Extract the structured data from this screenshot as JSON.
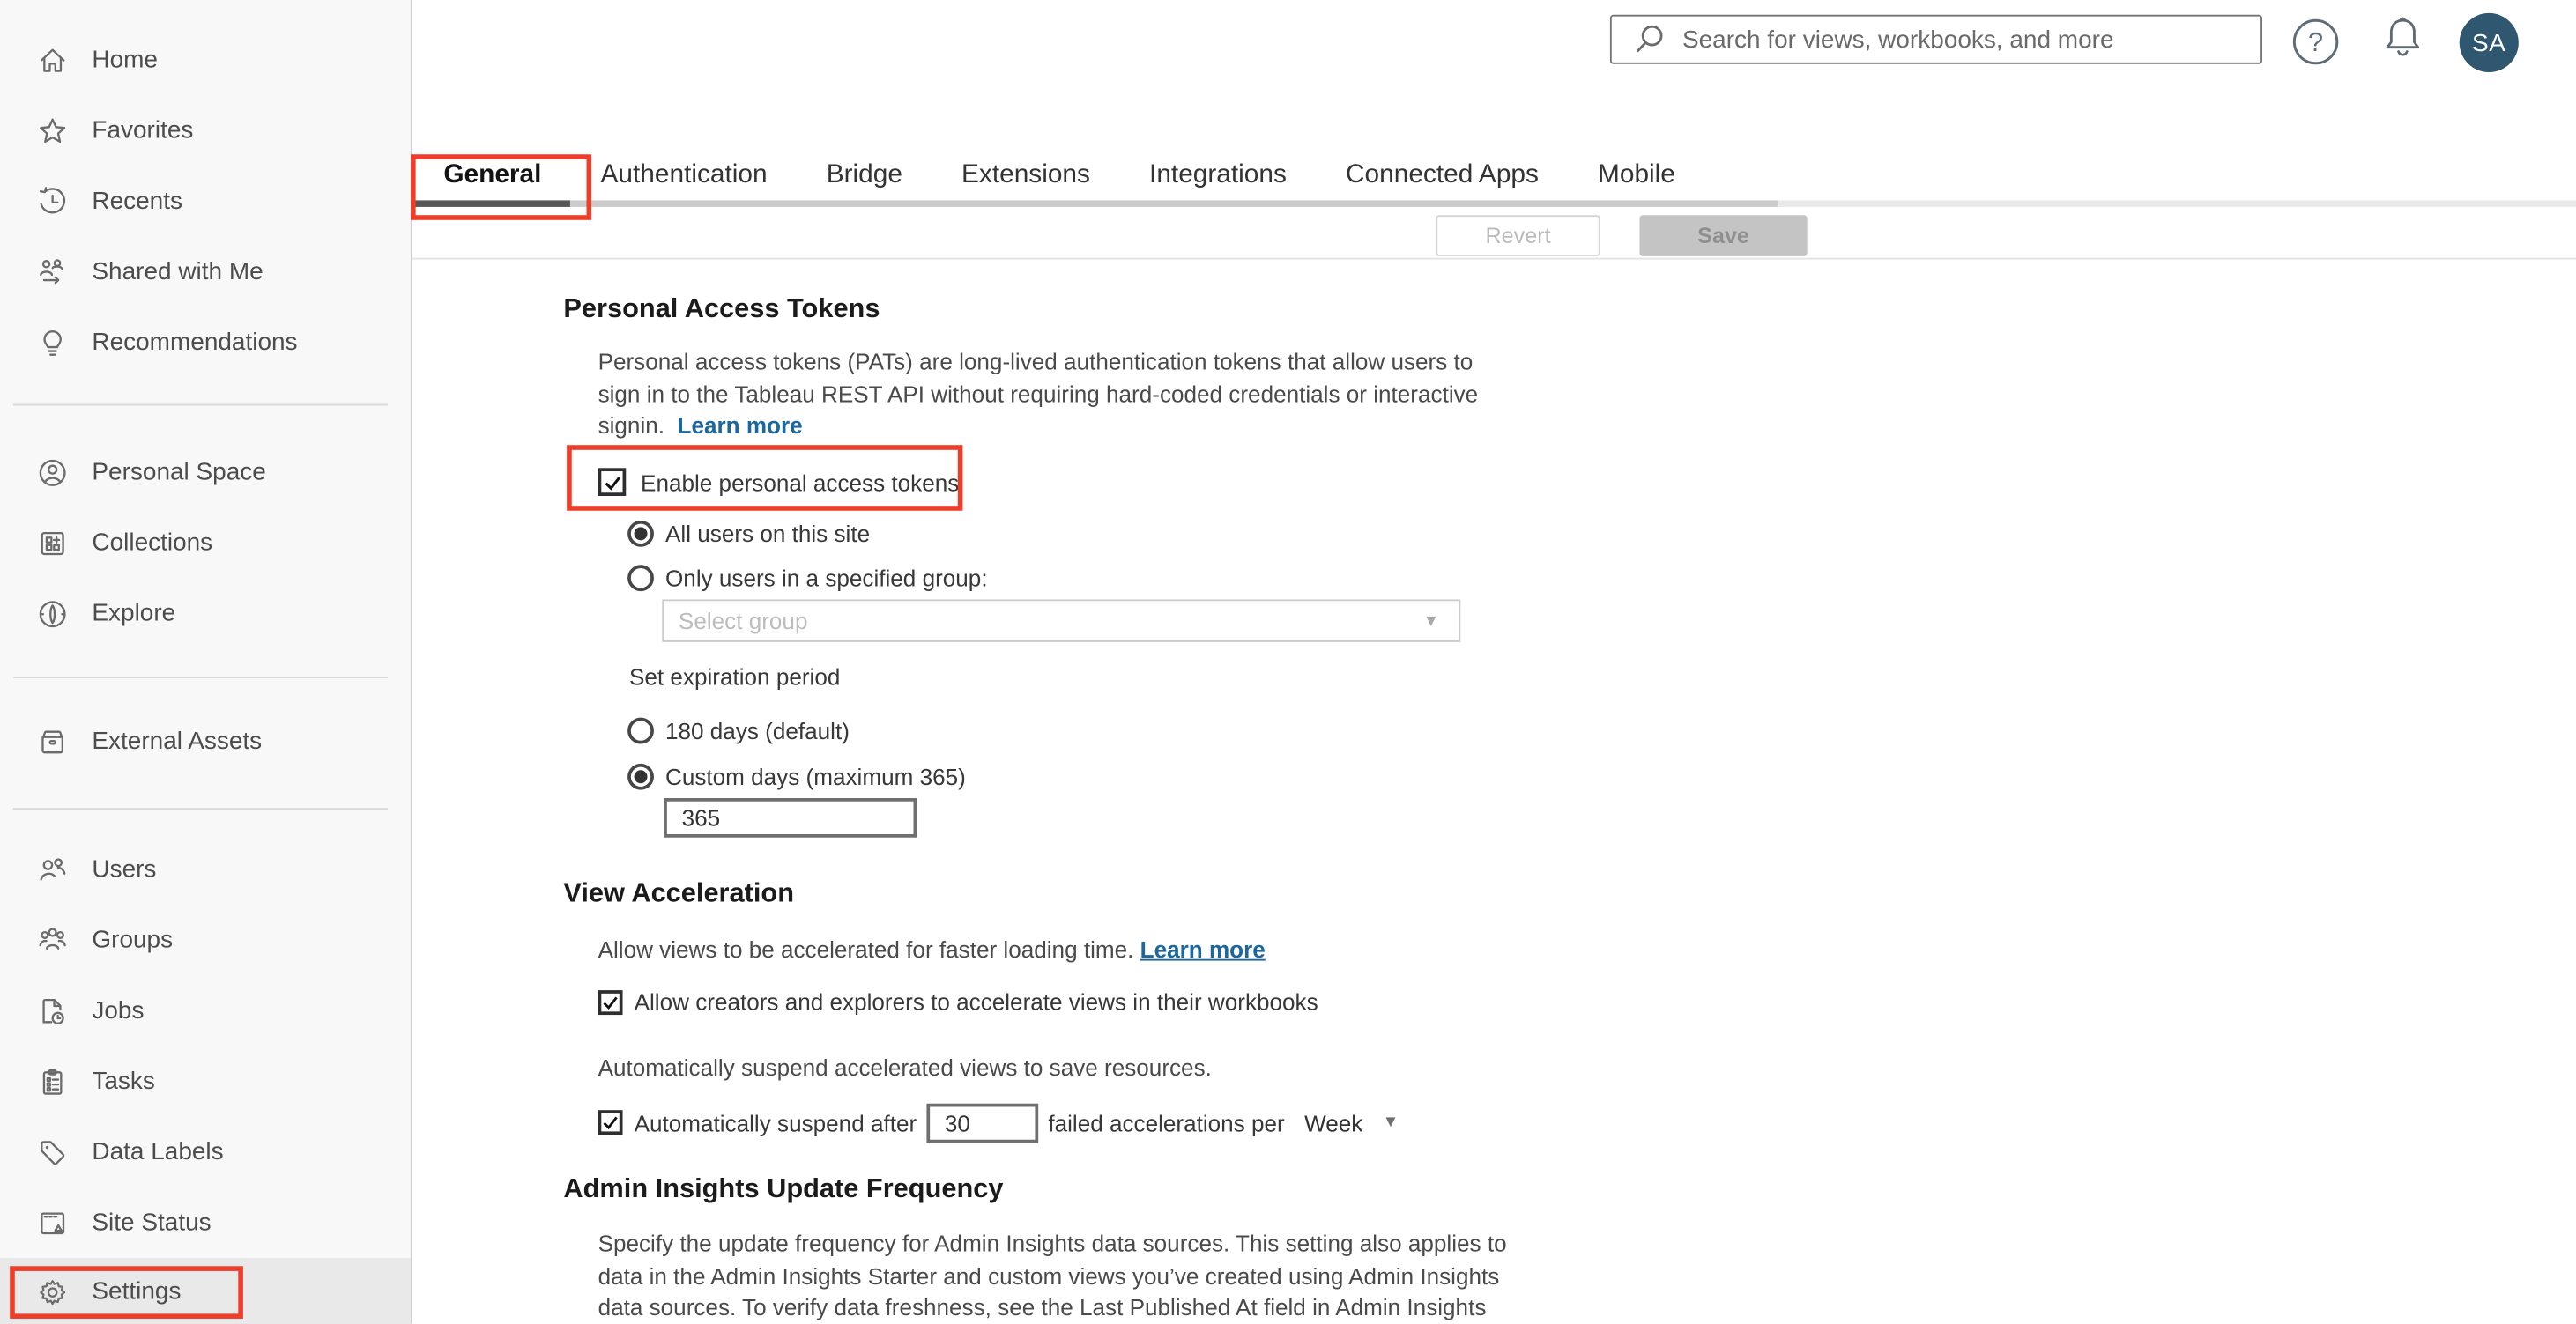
{
  "colors": {
    "accent_red": "#ee3e2a",
    "link_blue": "#1b679e",
    "avatar_bg": "#2f5770",
    "selected_tab_underline": "#575757"
  },
  "header": {
    "search_placeholder": "Search for views, workbooks, and more",
    "help_icon": "question-mark-circle",
    "notifications_icon": "bell",
    "avatar_initials": "SA"
  },
  "sidebar": {
    "items": [
      "Home",
      "Favorites",
      "Recents",
      "Shared with Me",
      "Recommendations",
      "Personal Space",
      "Collections",
      "Explore",
      "External Assets",
      "Users",
      "Groups",
      "Jobs",
      "Tasks",
      "Data Labels",
      "Site Status",
      "Settings"
    ],
    "selected_item": "Settings"
  },
  "tabs": {
    "items": [
      "General",
      "Authentication",
      "Bridge",
      "Extensions",
      "Integrations",
      "Connected Apps",
      "Mobile"
    ],
    "selected_tab": "General"
  },
  "toolbar": {
    "revert_label": "Revert",
    "save_label": "Save",
    "buttons_disabled": true
  },
  "sections": {
    "pat": {
      "title": "Personal Access Tokens",
      "description_lines": [
        "Personal access tokens (PATs) are long-lived authentication tokens that allow users to",
        "sign in to the Tableau REST API without requiring hard-coded credentials or interactive",
        "signin."
      ],
      "learn_more": "Learn more",
      "enable_label": "Enable personal access tokens",
      "enable_checked": true,
      "all_users_label": "All users on this site",
      "all_users_selected": true,
      "group_label": "Only users in a specified group:",
      "group_selected": false,
      "group_placeholder": "Select group",
      "expiration_label": "Set expiration period",
      "d180_label": "180 days (default)",
      "d180_selected": false,
      "custom_label": "Custom days (maximum 365)",
      "custom_selected": true,
      "custom_value": "365"
    },
    "view_acceleration": {
      "title": "View Acceleration",
      "intro": "Allow views to be accelerated for faster loading time.",
      "learn_more": "Learn more",
      "allow_label": "Allow creators and explorers to accelerate views in their workbooks",
      "allow_checked": true,
      "suspend_note": "Automatically suspend accelerated views to save resources.",
      "suspend_prefix": "Automatically suspend after",
      "suspend_value": "30",
      "suspend_suffix": "failed accelerations per",
      "suspend_period": "Week",
      "suspend_checked": true
    },
    "admin_insights": {
      "title": "Admin Insights Update Frequency",
      "description_lines": [
        "Specify the update frequency for Admin Insights data sources. This setting also applies to",
        "data in the Admin Insights Starter and custom views you’ve created using Admin Insights",
        "data sources. To verify data freshness, see the Last Published At field in Admin Insights"
      ]
    }
  }
}
